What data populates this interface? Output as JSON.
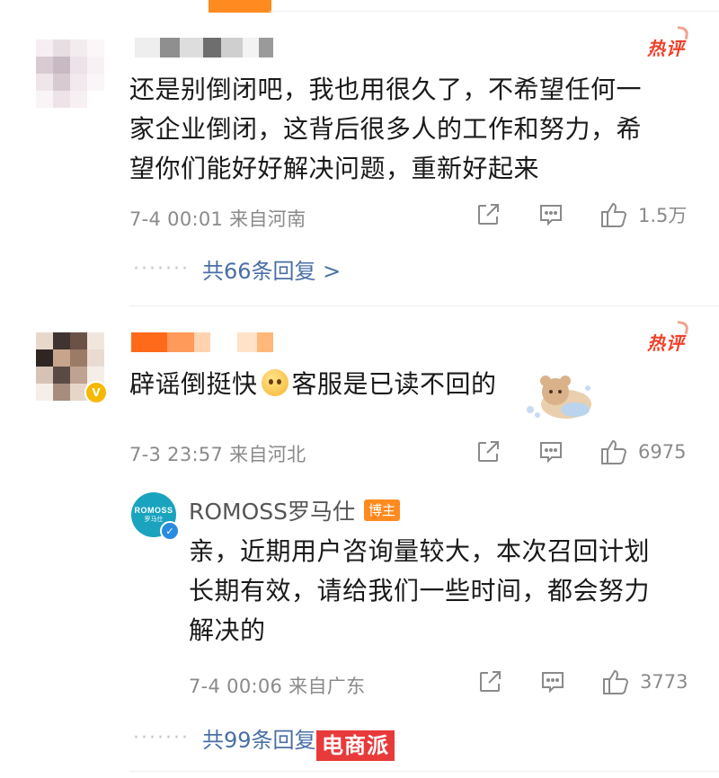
{
  "comments": [
    {
      "username": "",
      "hot_label": "热评",
      "text_lines": [
        "还是别倒闭吧，我也用很久了，不希望任何一",
        "家企业倒闭，这背后很多人的工作和努力，希",
        "望你们能好好解决问题，重新好起来"
      ],
      "meta": "7-4 00:01 来自河南",
      "like_count": "1.5万",
      "replies_link": "共66条回复 >",
      "dots": "·······"
    },
    {
      "username": "",
      "hot_label": "热评",
      "text_before": "辟谣倒挺快",
      "text_after": "客服是已读不回的",
      "meta": "7-3 23:57 来自河北",
      "like_count": "6975",
      "reply": {
        "avatar_text_1": "ROMOSS",
        "avatar_text_2": "罗马仕",
        "name": "ROMOSS罗马仕",
        "owner_tag": "博主",
        "text_lines": [
          "亲，近期用户咨询量较大，本次召回计划",
          "长期有效，请给我们一些时间，都会努力",
          "解决的"
        ],
        "meta": "7-4 00:06 来自广东",
        "like_count": "3773"
      },
      "replies_link": "共99条回复 >",
      "dots": "·······"
    }
  ],
  "watermark": "电商派",
  "colors": {
    "link": "#4a6fa5",
    "meta": "#8a8a8a",
    "hot": "#f0402a",
    "owner_tag": "#ff8a1f",
    "brand_avatar": "#1aa3bf"
  },
  "icons": [
    "share-icon",
    "comment-icon",
    "like-icon",
    "verified-icon"
  ]
}
